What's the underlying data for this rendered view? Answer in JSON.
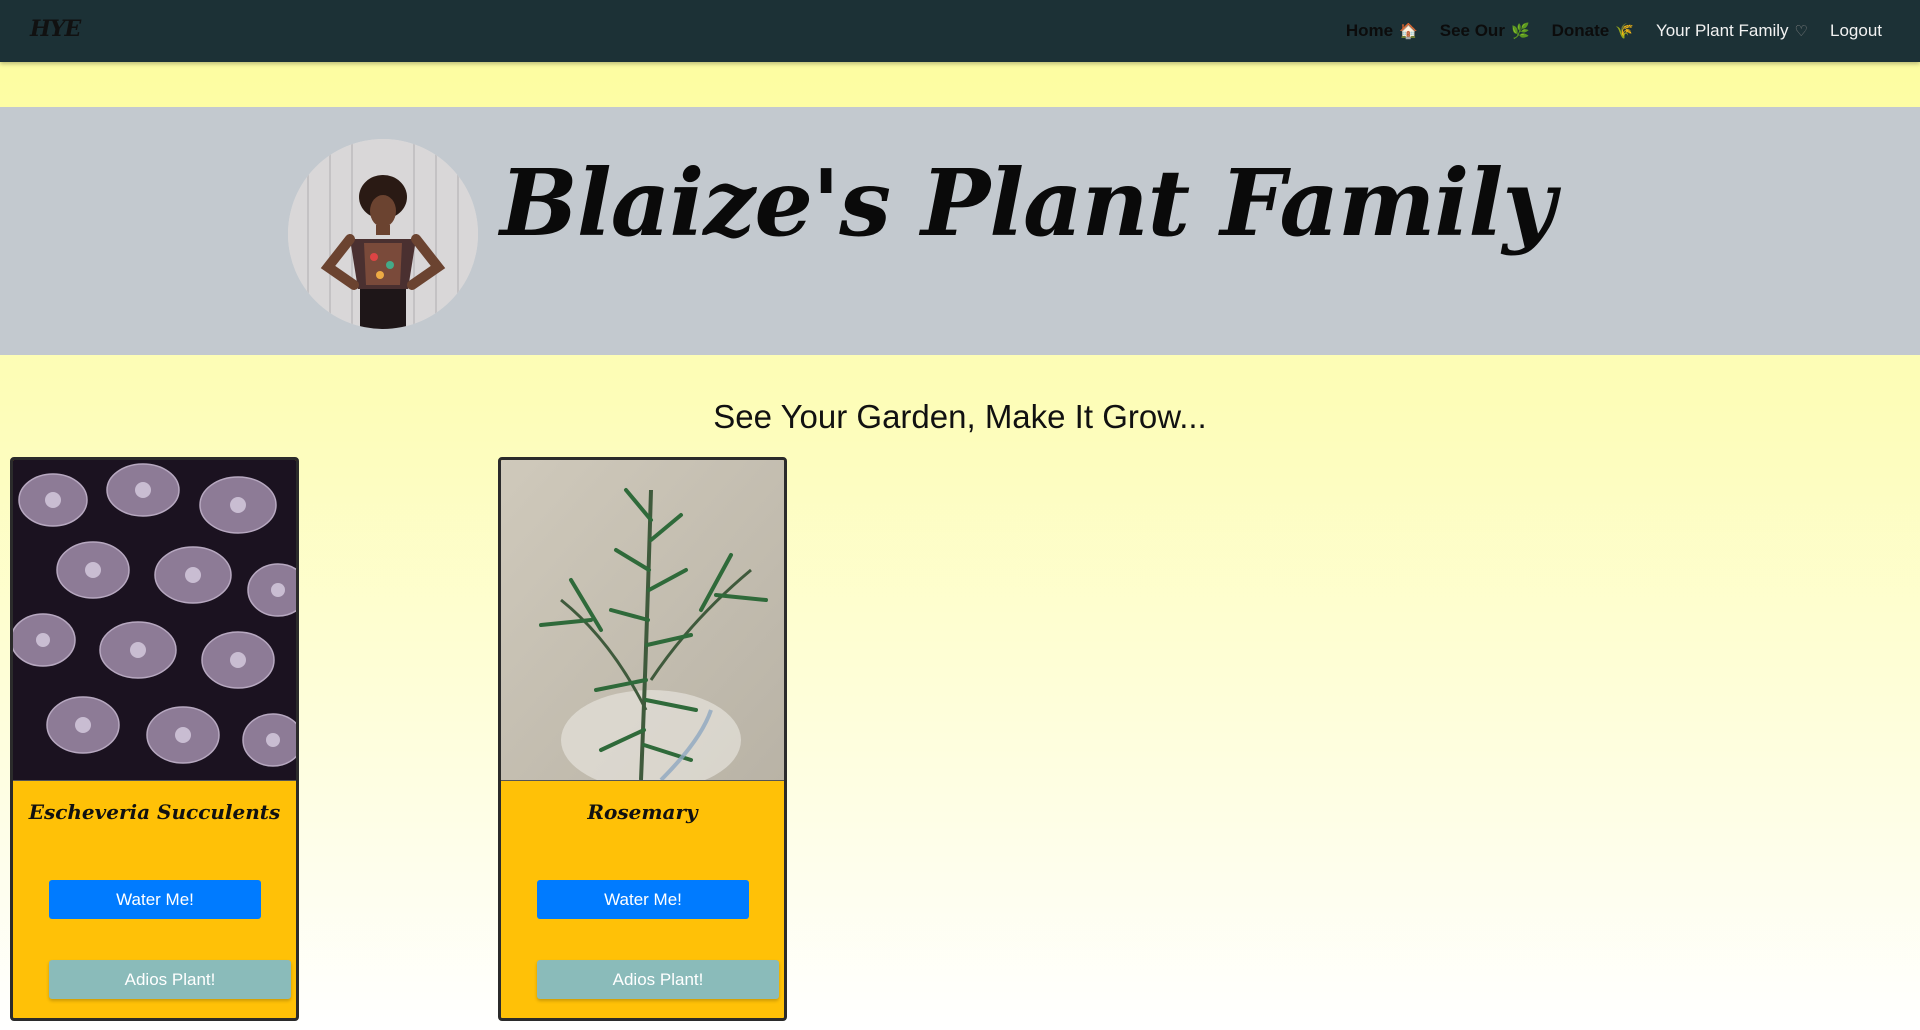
{
  "navbar": {
    "brand": "HYE",
    "links": [
      {
        "label": "Home",
        "icon": "house-icon",
        "glyph": "🏠"
      },
      {
        "label": "See Our",
        "icon": "leaf-icon",
        "glyph": "🌿"
      },
      {
        "label": "Donate",
        "icon": "seedling-icon",
        "glyph": "🌾"
      },
      {
        "label": "Your Plant Family",
        "icon": "heart-icon",
        "glyph": "♡"
      },
      {
        "label": "Logout"
      }
    ]
  },
  "hero": {
    "title": "Blaize's Plant Family",
    "avatar": "profile-photo"
  },
  "main": {
    "subtitle": "See Your Garden, Make It Grow..."
  },
  "plants": [
    {
      "name": "Escheveria Succulents",
      "water_label": "Water Me!",
      "remove_label": "Adios Plant!"
    },
    {
      "name": "Rosemary",
      "water_label": "Water Me!",
      "remove_label": "Adios Plant!"
    }
  ],
  "colors": {
    "navbar": "#1c3136",
    "hero": "#c3c9cf",
    "card": "#ffc107",
    "water_button": "#007bff",
    "remove_button": "#8abbba"
  }
}
